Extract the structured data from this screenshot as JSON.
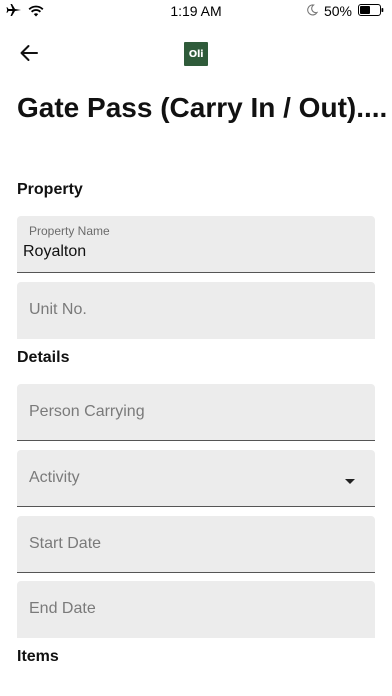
{
  "status_bar": {
    "time": "1:19 AM",
    "battery": "50%"
  },
  "header": {
    "logo_text": "Oli",
    "logo_color": "#2f5b3a"
  },
  "page": {
    "title": "Gate Pass (Carry In / Out)...."
  },
  "sections": {
    "property": "Property",
    "details": "Details",
    "items": "Items"
  },
  "fields": {
    "property_name": {
      "label": "Property Name",
      "value": "Royalton"
    },
    "unit_no": {
      "placeholder": "Unit No."
    },
    "person_carrying": {
      "placeholder": "Person Carrying"
    },
    "activity": {
      "placeholder": "Activity"
    },
    "start_date": {
      "placeholder": "Start Date"
    },
    "end_date": {
      "placeholder": "End Date"
    }
  },
  "icons": {
    "airplane": "airplane-icon",
    "wifi": "wifi-icon",
    "moon": "moon-icon",
    "battery": "battery-icon",
    "back": "back-arrow-icon",
    "dropdown": "dropdown-arrow-icon"
  }
}
